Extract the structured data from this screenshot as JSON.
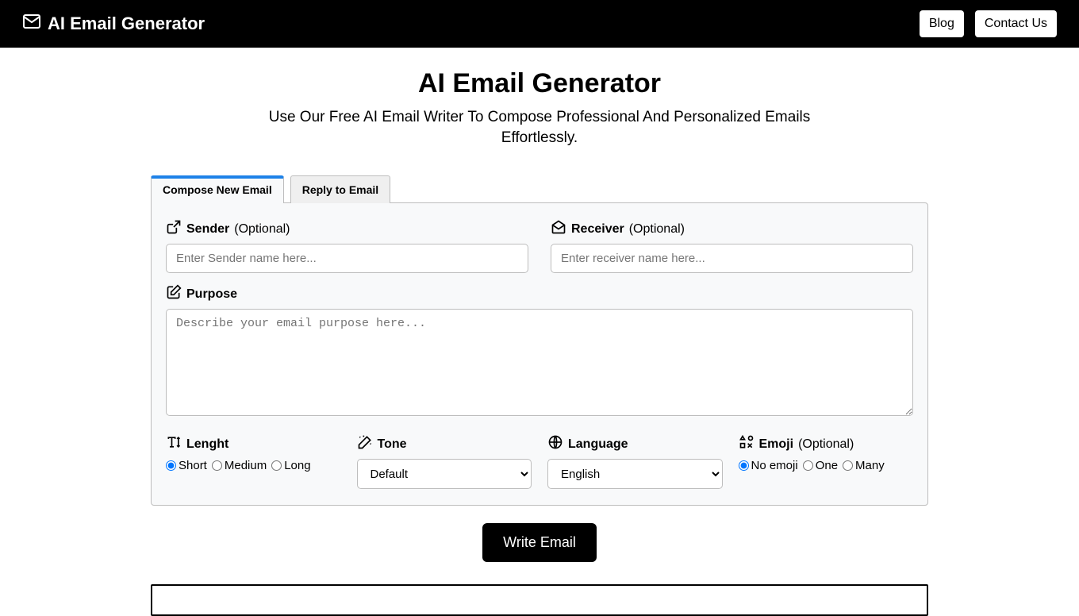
{
  "header": {
    "brand": "AI Email Generator",
    "nav": {
      "blog": "Blog",
      "contact": "Contact Us"
    }
  },
  "hero": {
    "title": "AI Email Generator",
    "subtitle": "Use Our Free AI Email Writer To Compose Professional And Personalized Emails Effortlessly."
  },
  "tabs": {
    "compose": "Compose New Email",
    "reply": "Reply to Email"
  },
  "form": {
    "sender": {
      "label": "Sender",
      "opt": "(Optional)",
      "placeholder": "Enter Sender name here..."
    },
    "receiver": {
      "label": "Receiver",
      "opt": "(Optional)",
      "placeholder": "Enter receiver name here..."
    },
    "purpose": {
      "label": "Purpose",
      "placeholder": "Describe your email purpose here..."
    },
    "length": {
      "label": "Lenght",
      "options": {
        "short": "Short",
        "medium": "Medium",
        "long": "Long"
      }
    },
    "tone": {
      "label": "Tone",
      "selected": "Default"
    },
    "language": {
      "label": "Language",
      "selected": "English"
    },
    "emoji": {
      "label": "Emoji",
      "opt": "(Optional)",
      "options": {
        "none": "No emoji",
        "one": "One",
        "many": "Many"
      }
    }
  },
  "actions": {
    "write": "Write Email"
  }
}
